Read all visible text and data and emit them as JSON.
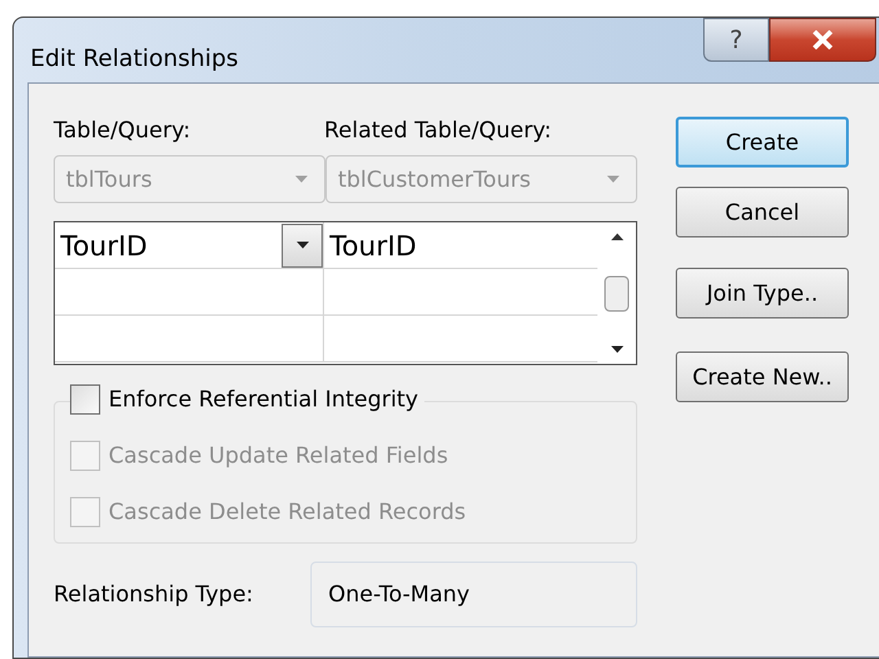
{
  "window": {
    "title": "Edit Relationships",
    "help": "?"
  },
  "table_query": {
    "label": "Table/Query:",
    "value": "tblTours",
    "disabled": true
  },
  "related_table_query": {
    "label": "Related Table/Query:",
    "value": "tblCustomerTours",
    "disabled": true
  },
  "grid": {
    "rows": [
      {
        "field": "TourID",
        "related_field": "TourID"
      }
    ]
  },
  "options": [
    {
      "label": "Enforce Referential Integrity",
      "checked": false,
      "disabled": false
    },
    {
      "label": "Cascade Update Related Fields",
      "checked": false,
      "disabled": true
    },
    {
      "label": "Cascade Delete Related Records",
      "checked": false,
      "disabled": true
    }
  ],
  "relationship_type": {
    "label": "Relationship Type:",
    "value": "One-To-Many"
  },
  "buttons": [
    {
      "label": "Create",
      "default": true
    },
    {
      "label": "Cancel",
      "default": false
    },
    {
      "label": "Join Type..",
      "default": false
    },
    {
      "label": "Create New..",
      "default": false
    }
  ]
}
